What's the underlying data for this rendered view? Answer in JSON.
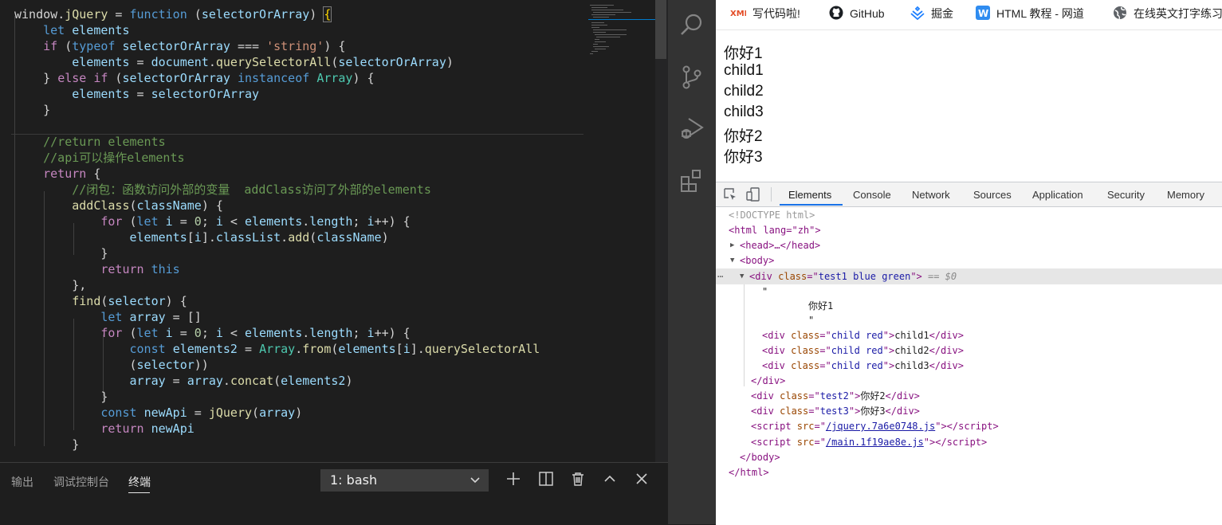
{
  "editor": {
    "lines": [
      [
        [
          "window",
          "pun"
        ],
        [
          ".",
          "pun"
        ],
        [
          "jQuery",
          "fn"
        ],
        [
          " = ",
          "pun"
        ],
        [
          "function",
          "kw"
        ],
        [
          " (",
          "pun"
        ],
        [
          "selectorOrArray",
          "var"
        ],
        [
          ") ",
          "pun"
        ],
        [
          "{",
          "brk"
        ]
      ],
      [
        [
          "    "
        ],
        [
          "let",
          "kw"
        ],
        [
          " "
        ],
        [
          "elements",
          "var"
        ]
      ],
      [
        [
          "    "
        ],
        [
          "if",
          "ctl"
        ],
        [
          " ("
        ],
        [
          "typeof",
          "kw"
        ],
        [
          " "
        ],
        [
          "selectorOrArray",
          "var"
        ],
        [
          " === "
        ],
        [
          "'string'",
          "str"
        ],
        [
          ") {"
        ]
      ],
      [
        [
          "        "
        ],
        [
          "elements",
          "var"
        ],
        [
          " = "
        ],
        [
          "document",
          "var"
        ],
        [
          "."
        ],
        [
          "querySelectorAll",
          "fn"
        ],
        [
          "("
        ],
        [
          "selectorOrArray",
          "var"
        ],
        [
          ")"
        ]
      ],
      [
        [
          "    } "
        ],
        [
          "else",
          "ctl"
        ],
        [
          " "
        ],
        [
          "if",
          "ctl"
        ],
        [
          " ("
        ],
        [
          "selectorOrArray",
          "var"
        ],
        [
          " "
        ],
        [
          "instanceof",
          "kw"
        ],
        [
          " "
        ],
        [
          "Array",
          "cls"
        ],
        [
          ") {"
        ]
      ],
      [
        [
          "        "
        ],
        [
          "elements",
          "var"
        ],
        [
          " = "
        ],
        [
          "selectorOrArray",
          "var"
        ]
      ],
      [
        [
          "    }"
        ]
      ],
      [
        [
          ""
        ]
      ],
      [
        [
          "    "
        ],
        [
          "//return elements",
          "cmt"
        ]
      ],
      [
        [
          "    "
        ],
        [
          "//api可以操作elements",
          "cmt"
        ]
      ],
      [
        [
          "    "
        ],
        [
          "return",
          "ctl"
        ],
        [
          " {"
        ]
      ],
      [
        [
          "        "
        ],
        [
          "//闭包：函数访问外部的变量  addClass访问了外部的elements",
          "cmt"
        ]
      ],
      [
        [
          "        "
        ],
        [
          "addClass",
          "fn"
        ],
        [
          "("
        ],
        [
          "className",
          "var"
        ],
        [
          ") {"
        ]
      ],
      [
        [
          "            "
        ],
        [
          "for",
          "ctl"
        ],
        [
          " ("
        ],
        [
          "let",
          "kw"
        ],
        [
          " "
        ],
        [
          "i",
          "var"
        ],
        [
          " = "
        ],
        [
          "0",
          "num"
        ],
        [
          "; "
        ],
        [
          "i",
          "var"
        ],
        [
          " < "
        ],
        [
          "elements",
          "var"
        ],
        [
          "."
        ],
        [
          "length",
          "var"
        ],
        [
          "; "
        ],
        [
          "i",
          "var"
        ],
        [
          "++) {"
        ]
      ],
      [
        [
          "                "
        ],
        [
          "elements",
          "var"
        ],
        [
          "["
        ],
        [
          "i",
          "var"
        ],
        [
          "]."
        ],
        [
          "classList",
          "var"
        ],
        [
          "."
        ],
        [
          "add",
          "fn"
        ],
        [
          "("
        ],
        [
          "className",
          "var"
        ],
        [
          ")"
        ]
      ],
      [
        [
          "            }"
        ]
      ],
      [
        [
          "            "
        ],
        [
          "return",
          "ctl"
        ],
        [
          " "
        ],
        [
          "this",
          "kw"
        ]
      ],
      [
        [
          "        },"
        ]
      ],
      [
        [
          "        "
        ],
        [
          "find",
          "fn"
        ],
        [
          "("
        ],
        [
          "selector",
          "var"
        ],
        [
          ") {"
        ]
      ],
      [
        [
          "            "
        ],
        [
          "let",
          "kw"
        ],
        [
          " "
        ],
        [
          "array",
          "var"
        ],
        [
          " = []"
        ]
      ],
      [
        [
          "            "
        ],
        [
          "for",
          "ctl"
        ],
        [
          " ("
        ],
        [
          "let",
          "kw"
        ],
        [
          " "
        ],
        [
          "i",
          "var"
        ],
        [
          " = "
        ],
        [
          "0",
          "num"
        ],
        [
          "; "
        ],
        [
          "i",
          "var"
        ],
        [
          " < "
        ],
        [
          "elements",
          "var"
        ],
        [
          "."
        ],
        [
          "length",
          "var"
        ],
        [
          "; "
        ],
        [
          "i",
          "var"
        ],
        [
          "++) {"
        ]
      ],
      [
        [
          "                "
        ],
        [
          "const",
          "kw"
        ],
        [
          " "
        ],
        [
          "elements2",
          "var"
        ],
        [
          " = "
        ],
        [
          "Array",
          "cls"
        ],
        [
          "."
        ],
        [
          "from",
          "fn"
        ],
        [
          "("
        ],
        [
          "elements",
          "var"
        ],
        [
          "["
        ],
        [
          "i",
          "var"
        ],
        [
          "]."
        ],
        [
          "querySelectorAll",
          "fn"
        ]
      ],
      [
        [
          "                ("
        ],
        [
          "selector",
          "var"
        ],
        [
          "))"
        ]
      ],
      [
        [
          "                "
        ],
        [
          "array",
          "var"
        ],
        [
          " = "
        ],
        [
          "array",
          "var"
        ],
        [
          "."
        ],
        [
          "concat",
          "fn"
        ],
        [
          "("
        ],
        [
          "elements2",
          "var"
        ],
        [
          ")"
        ]
      ],
      [
        [
          "            }"
        ]
      ],
      [
        [
          "            "
        ],
        [
          "const",
          "kw"
        ],
        [
          " "
        ],
        [
          "newApi",
          "var"
        ],
        [
          " = "
        ],
        [
          "jQuery",
          "fn"
        ],
        [
          "("
        ],
        [
          "array",
          "var"
        ],
        [
          ")"
        ]
      ],
      [
        [
          "            "
        ],
        [
          "return",
          "ctl"
        ],
        [
          " "
        ],
        [
          "newApi",
          "var"
        ]
      ],
      [
        [
          "        }"
        ]
      ]
    ]
  },
  "panel": {
    "tabs": [
      "输出",
      "调试控制台",
      "终端"
    ],
    "active_tab": "终端",
    "terminal": "1: bash"
  },
  "activity_icons": [
    "search-icon",
    "source-control-icon",
    "run-debug-icon",
    "extensions-icon"
  ],
  "browser": {
    "bookmarks": [
      {
        "label": "写代码啦!",
        "icon": "xml-icon"
      },
      {
        "label": "GitHub",
        "icon": "github-icon"
      },
      {
        "label": "掘金",
        "icon": "juejin-icon"
      },
      {
        "label": "HTML 教程 - 网道",
        "icon": "w-icon"
      },
      {
        "label": "在线英文打字练习",
        "icon": "globe-icon"
      }
    ],
    "page_lines": [
      "你好1",
      "child1",
      "child2",
      "child3",
      "你好2",
      "你好3"
    ]
  },
  "devtools": {
    "tabs": [
      "Elements",
      "Console",
      "Network",
      "Sources",
      "Application",
      "Security",
      "Memory"
    ],
    "active_tab": "Elements",
    "dom": {
      "doctype": "<!DOCTYPE html>",
      "html_open": "<html lang=\"zh\">",
      "head": "<head>…</head>",
      "body_open": "<body>",
      "selected_div": "<div class=\"test1 blue green\"> == $0",
      "text_node": "你好1",
      "children": [
        "child1",
        "child2",
        "child3"
      ],
      "child_class": "child red",
      "test2": "你好2",
      "test3": "你好3",
      "scripts": [
        "/jquery.7a6e0748.js",
        "/main.1f19ae8e.js"
      ]
    }
  },
  "colors": {
    "editor_bg": "#1e1e1e",
    "activity_bg": "#333333",
    "keyword": "#569cd6",
    "control": "#c586c0",
    "variable": "#9cdcfe",
    "function": "#dcdcaa",
    "string": "#ce9178",
    "comment": "#6a9955",
    "devtools_accent": "#1a73e8"
  }
}
